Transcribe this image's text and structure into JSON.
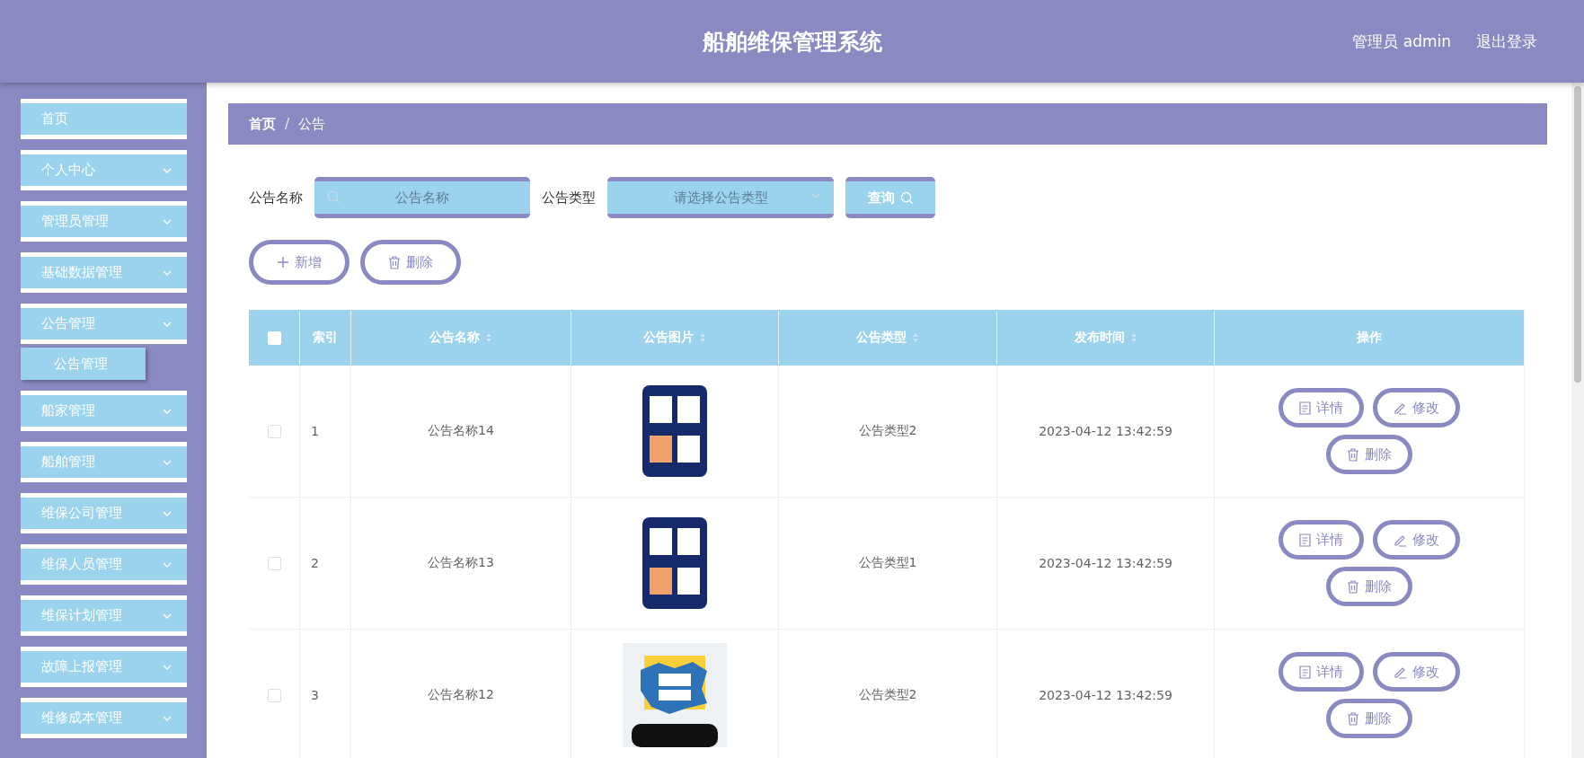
{
  "header": {
    "title": "船舶维保管理系统",
    "user": "管理员 admin",
    "logout": "退出登录"
  },
  "sidebar": {
    "items": [
      {
        "label": "首页",
        "kind": "link"
      },
      {
        "label": "个人中心",
        "kind": "submenu"
      },
      {
        "label": "管理员管理",
        "kind": "submenu"
      },
      {
        "label": "基础数据管理",
        "kind": "submenu"
      },
      {
        "label": "公告管理",
        "kind": "submenu",
        "children": [
          {
            "label": "公告管理"
          }
        ]
      },
      {
        "label": "船家管理",
        "kind": "submenu"
      },
      {
        "label": "船舶管理",
        "kind": "submenu"
      },
      {
        "label": "维保公司管理",
        "kind": "submenu"
      },
      {
        "label": "维保人员管理",
        "kind": "submenu"
      },
      {
        "label": "维保计划管理",
        "kind": "submenu"
      },
      {
        "label": "故障上报管理",
        "kind": "submenu"
      },
      {
        "label": "维修成本管理",
        "kind": "submenu"
      }
    ]
  },
  "breadcrumb": {
    "items": [
      "首页",
      "公告"
    ],
    "separator": "/"
  },
  "search": {
    "name_label": "公告名称",
    "name_placeholder": "公告名称",
    "type_label": "公告类型",
    "type_placeholder": "请选择公告类型",
    "query_button": "查询"
  },
  "actions": {
    "add": "新增",
    "delete": "删除"
  },
  "table": {
    "header_checked": false,
    "columns": [
      {
        "label": "索引",
        "sortable": false
      },
      {
        "label": "公告名称",
        "sortable": true
      },
      {
        "label": "公告图片",
        "sortable": true
      },
      {
        "label": "公告类型",
        "sortable": true
      },
      {
        "label": "发布时间",
        "sortable": true
      },
      {
        "label": "操作",
        "sortable": false
      }
    ],
    "rows": [
      {
        "checked": false,
        "index": "1",
        "name": "公告名称14",
        "type": "公告类型2",
        "time": "2023-04-12 13:42:59",
        "buttons": [
          "详情",
          "修改",
          "删除"
        ]
      },
      {
        "checked": false,
        "index": "2",
        "name": "公告名称13",
        "type": "公告类型1",
        "time": "2023-04-12 13:42:59",
        "buttons": [
          "详情",
          "修改",
          "删除"
        ]
      },
      {
        "checked": false,
        "index": "3",
        "name": "公告名称12",
        "type": "公告类型2",
        "time": "2023-04-12 13:42:59",
        "buttons": [
          "详情",
          "修改",
          "删除"
        ]
      }
    ]
  }
}
